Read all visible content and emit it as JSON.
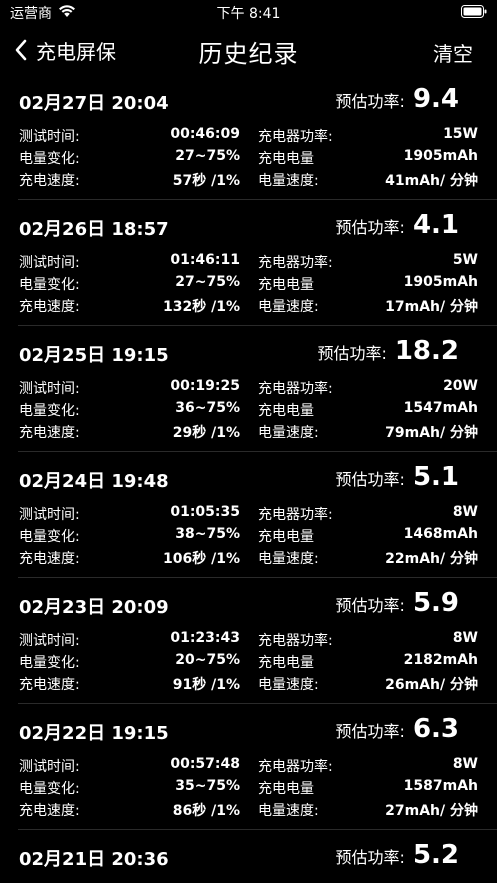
{
  "status": {
    "carrier": "运营商",
    "time": "下午 8:41"
  },
  "nav": {
    "back_label": "充电屏保",
    "title": "历史纪录",
    "clear_label": "清空"
  },
  "labels": {
    "test_time": "测试时间:",
    "battery_change": "电量变化:",
    "charge_speed": "充电速度:",
    "charger_power": "充电器功率:",
    "charge_amount": "充电电量",
    "amount_speed": "电量速度:",
    "est_power": "预估功率:"
  },
  "records": [
    {
      "date": "02月27日 20:04",
      "est_power": "9.4",
      "test_time": "00:46:09",
      "charger_power": "15W",
      "battery_change": "27~75%",
      "charge_amount": "1905mAh",
      "charge_speed": "57秒 /1%",
      "amount_speed": "41mAh/ 分钟"
    },
    {
      "date": "02月26日 18:57",
      "est_power": "4.1",
      "test_time": "01:46:11",
      "charger_power": "5W",
      "battery_change": "27~75%",
      "charge_amount": "1905mAh",
      "charge_speed": "132秒 /1%",
      "amount_speed": "17mAh/ 分钟"
    },
    {
      "date": "02月25日 19:15",
      "est_power": "18.2",
      "test_time": "00:19:25",
      "charger_power": "20W",
      "battery_change": "36~75%",
      "charge_amount": "1547mAh",
      "charge_speed": "29秒 /1%",
      "amount_speed": "79mAh/ 分钟"
    },
    {
      "date": "02月24日 19:48",
      "est_power": "5.1",
      "test_time": "01:05:35",
      "charger_power": "8W",
      "battery_change": "38~75%",
      "charge_amount": "1468mAh",
      "charge_speed": "106秒 /1%",
      "amount_speed": "22mAh/ 分钟"
    },
    {
      "date": "02月23日 20:09",
      "est_power": "5.9",
      "test_time": "01:23:43",
      "charger_power": "8W",
      "battery_change": "20~75%",
      "charge_amount": "2182mAh",
      "charge_speed": "91秒 /1%",
      "amount_speed": "26mAh/ 分钟"
    },
    {
      "date": "02月22日 19:15",
      "est_power": "6.3",
      "test_time": "00:57:48",
      "charger_power": "8W",
      "battery_change": "35~75%",
      "charge_amount": "1587mAh",
      "charge_speed": "86秒 /1%",
      "amount_speed": "27mAh/ 分钟"
    },
    {
      "date": "02月21日 20:36",
      "est_power": "5.2"
    }
  ]
}
